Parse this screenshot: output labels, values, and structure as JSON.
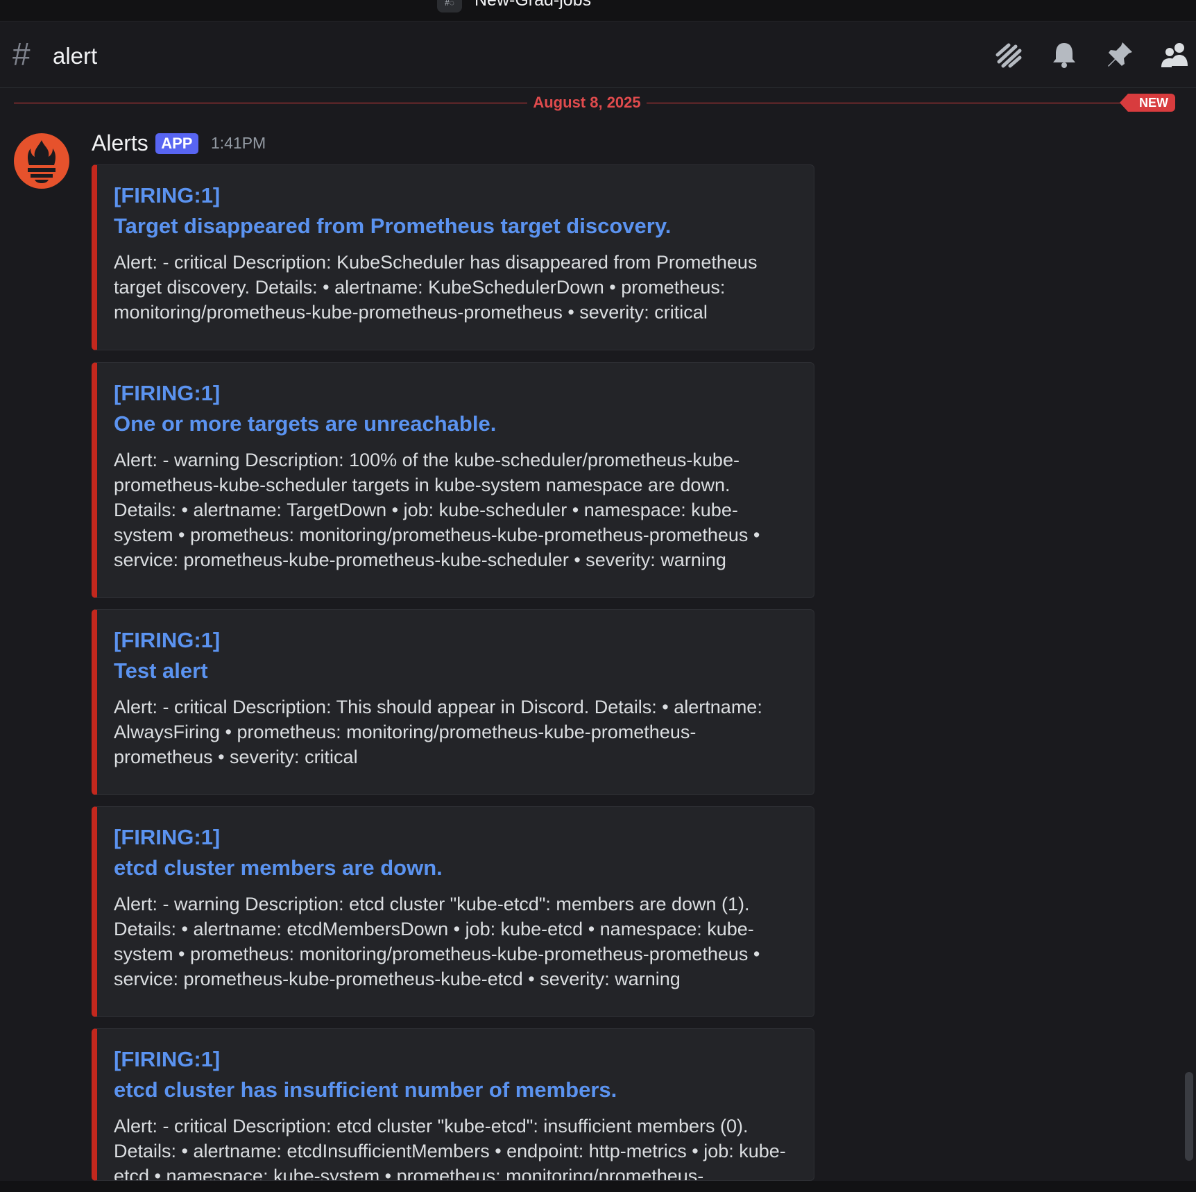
{
  "topbar": {
    "server_icon_text": "#◌",
    "server_name": "New-Grad-jobs"
  },
  "header": {
    "channel_symbol": "#",
    "channel_name": "alert",
    "icons": [
      "threads-icon",
      "bell-icon",
      "pin-icon",
      "members-icon"
    ]
  },
  "divider": {
    "date": "August 8, 2025",
    "new_label": "NEW"
  },
  "message": {
    "author": "Alerts",
    "badge": "APP",
    "time": "1:41PM",
    "avatar_icon": "prometheus-icon",
    "embed_color": "#c3281e",
    "embeds": [
      {
        "title_line1": "[FIRING:1]",
        "title_line2": "Target disappeared from Prometheus target discovery.",
        "description": "Alert: - critical Description: KubeScheduler has disappeared from Prometheus target discovery. Details: • alertname: KubeSchedulerDown • prometheus: monitoring/prometheus-kube-prometheus-prometheus • severity: critical"
      },
      {
        "title_line1": "[FIRING:1]",
        "title_line2": "One or more targets are unreachable.",
        "description": "Alert: - warning Description: 100% of the kube-scheduler/prometheus-kube-prometheus-kube-scheduler targets in kube-system namespace are down. Details: • alertname: TargetDown • job: kube-scheduler • namespace: kube-system • prometheus: monitoring/prometheus-kube-prometheus-prometheus • service: prometheus-kube-prometheus-kube-scheduler • severity: warning"
      },
      {
        "title_line1": "[FIRING:1]",
        "title_line2": "Test alert",
        "description": "Alert: - critical Description: This should appear in Discord. Details: • alertname: AlwaysFiring • prometheus: monitoring/prometheus-kube-prometheus-prometheus • severity: critical"
      },
      {
        "title_line1": "[FIRING:1]",
        "title_line2": "etcd cluster members are down.",
        "description": "Alert: - warning Description: etcd cluster \"kube-etcd\": members are down (1). Details: • alertname: etcdMembersDown • job: kube-etcd • namespace: kube-system • prometheus: monitoring/prometheus-kube-prometheus-prometheus • service: prometheus-kube-prometheus-kube-etcd • severity: warning"
      },
      {
        "title_line1": "[FIRING:1]",
        "title_line2": "etcd cluster has insufficient number of members.",
        "description": "Alert: - critical Description: etcd cluster \"kube-etcd\": insufficient members (0). Details: • alertname: etcdInsufficientMembers • endpoint: http-metrics • job: kube-etcd • namespace: kube-system • prometheus: monitoring/prometheus-"
      }
    ]
  }
}
